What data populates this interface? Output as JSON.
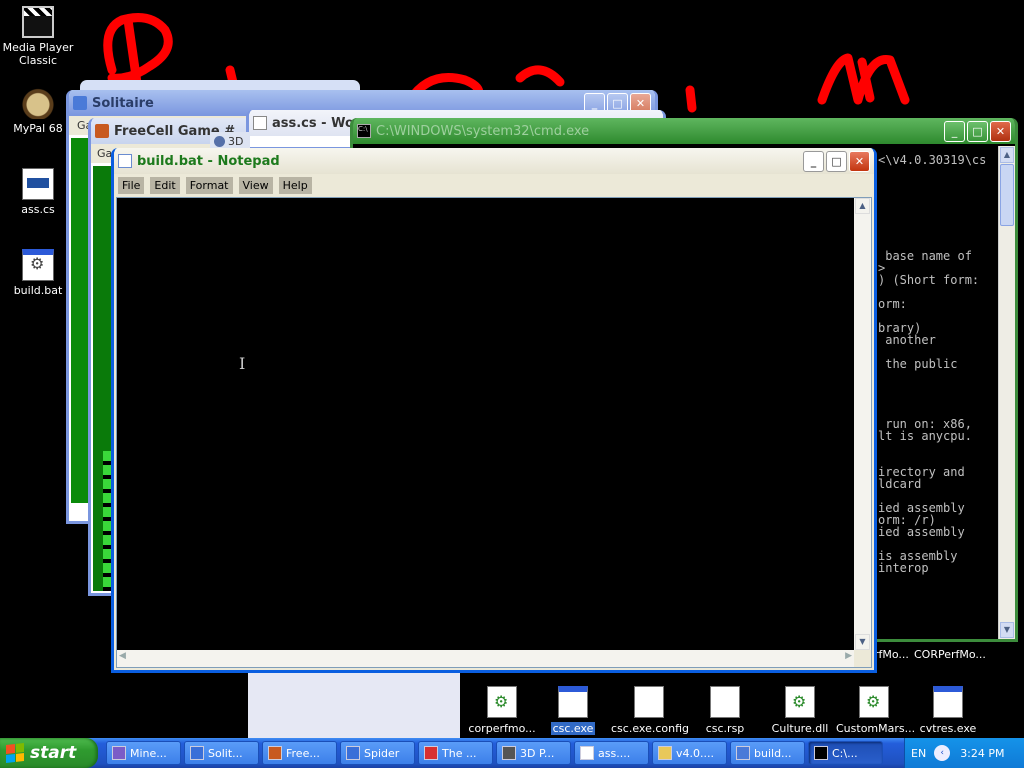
{
  "desktop": {
    "icons": [
      {
        "label_line1": "Media Player",
        "label_line2": "Classic",
        "icon": "media-player-icon"
      },
      {
        "label_line1": "MyPal 68",
        "label_line2": "",
        "icon": "browser-icon"
      },
      {
        "label_line1": "ass.cs",
        "label_line2": "",
        "icon": "cs-file-icon"
      },
      {
        "label_line1": "build.bat",
        "label_line2": "",
        "icon": "batch-file-icon"
      }
    ]
  },
  "windows": {
    "solitaire_title": "Solitaire",
    "solitaire_menu": "Ga",
    "freecell_title": "FreeCell Game #",
    "freecell_menu": "Ga",
    "word_title": "ass.cs - Wor",
    "other_tab": "3D",
    "cmd_title": "C:\\WINDOWS\\system32\\cmd.exe",
    "cmd_lines": [
      "<\\v4.0.30319\\cs",
      "",
      "",
      "",
      "",
      "",
      "",
      "",
      " base name of",
      ">",
      ") (Short form:",
      "",
      "orm:",
      "",
      "brary)",
      " another",
      "",
      " the public",
      "",
      "",
      "",
      "",
      " run on: x86,",
      "lt is anycpu.",
      "",
      "",
      "irectory and",
      "ldcard",
      "",
      "ied assembly",
      "orm: /r)",
      "ied assembly",
      "",
      "is assembly",
      "interop"
    ],
    "side_items": [
      "rfMo...",
      "CORPerfMo..."
    ]
  },
  "notepad": {
    "title": "build.bat - Notepad",
    "menu": [
      "File",
      "Edit",
      "Format",
      "View",
      "Help"
    ],
    "content": ""
  },
  "folder_icons": [
    {
      "label": "corperfmo...",
      "type": "gear",
      "selected": false
    },
    {
      "label": "csc.exe",
      "type": "exe",
      "selected": true
    },
    {
      "label": "csc.exe.config",
      "type": "doc",
      "selected": false
    },
    {
      "label": "csc.rsp",
      "type": "doc",
      "selected": false
    },
    {
      "label": "Culture.dll",
      "type": "gear",
      "selected": false
    },
    {
      "label": "CustomMars...",
      "type": "gear",
      "selected": false
    },
    {
      "label": "cvtres.exe",
      "type": "exe",
      "selected": false
    }
  ],
  "taskbar": {
    "start_label": "start",
    "tasks": [
      {
        "label": "Mine...",
        "color": "#7b5cc7"
      },
      {
        "label": "Solit...",
        "color": "#3a6fd8"
      },
      {
        "label": "Free...",
        "color": "#c85a20"
      },
      {
        "label": "Spider",
        "color": "#3a6fd8"
      },
      {
        "label": "The ...",
        "color": "#d83030"
      },
      {
        "label": "3D P...",
        "color": "#555555"
      },
      {
        "label": "ass....",
        "color": "#ffffff"
      },
      {
        "label": "v4.0....",
        "color": "#e8c85a"
      },
      {
        "label": "build...",
        "color": "#4a7ad8"
      },
      {
        "label": "C:\\...",
        "color": "#000000"
      }
    ],
    "language": "EN",
    "time": "3:24 PM"
  },
  "colors": {
    "scribble": "#ff0000",
    "desktop_bg": "#000000",
    "xp_blue": "#0a5ee0"
  }
}
